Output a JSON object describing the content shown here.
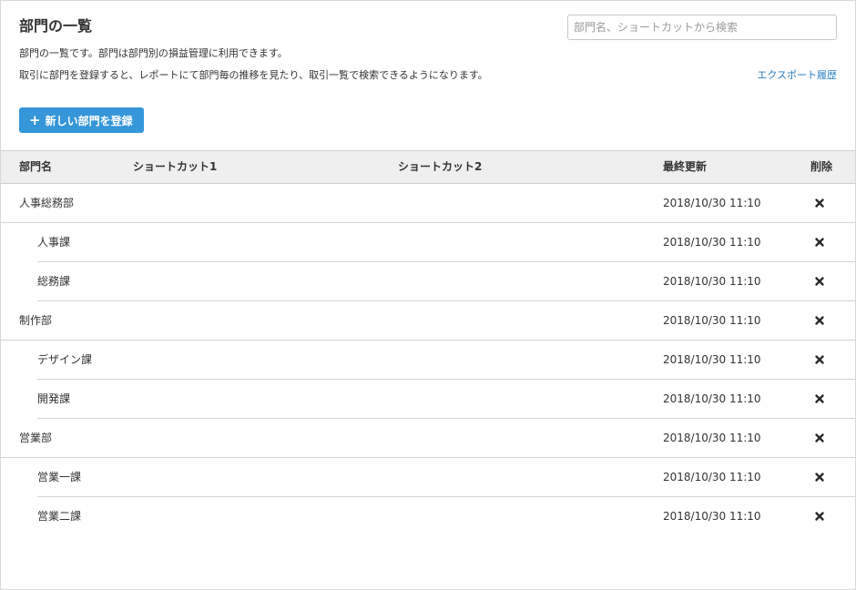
{
  "header": {
    "title": "部門の一覧",
    "search_placeholder": "部門名、ショートカットから検索",
    "search_value": "",
    "description_line1": "部門の一覧です。部門は部門別の損益管理に利用できます。",
    "description_line2": "取引に部門を登録すると、レポートにて部門毎の推移を見たり、取引一覧で検索できるようになります。",
    "export_link": "エクスポート履歴"
  },
  "actions": {
    "add_button_icon": "plus-icon",
    "add_button_label": "新しい部門を登録",
    "accent_color": "#3596d9"
  },
  "table": {
    "columns": {
      "name": "部門名",
      "shortcut1": "ショートカット1",
      "shortcut2": "ショートカット2",
      "updated": "最終更新",
      "delete": "削除"
    },
    "delete_icon": "close-icon",
    "rows": [
      {
        "name": "人事総務部",
        "level": 0,
        "shortcut1": "",
        "shortcut2": "",
        "updated": "2018/10/30 11:10"
      },
      {
        "name": "人事課",
        "level": 1,
        "shortcut1": "",
        "shortcut2": "",
        "updated": "2018/10/30 11:10"
      },
      {
        "name": "総務課",
        "level": 1,
        "shortcut1": "",
        "shortcut2": "",
        "updated": "2018/10/30 11:10"
      },
      {
        "name": "制作部",
        "level": 0,
        "shortcut1": "",
        "shortcut2": "",
        "updated": "2018/10/30 11:10"
      },
      {
        "name": "デザイン課",
        "level": 1,
        "shortcut1": "",
        "shortcut2": "",
        "updated": "2018/10/30 11:10"
      },
      {
        "name": "開発課",
        "level": 1,
        "shortcut1": "",
        "shortcut2": "",
        "updated": "2018/10/30 11:10"
      },
      {
        "name": "営業部",
        "level": 0,
        "shortcut1": "",
        "shortcut2": "",
        "updated": "2018/10/30 11:10"
      },
      {
        "name": "営業一課",
        "level": 1,
        "shortcut1": "",
        "shortcut2": "",
        "updated": "2018/10/30 11:10"
      },
      {
        "name": "営業二課",
        "level": 1,
        "shortcut1": "",
        "shortcut2": "",
        "updated": "2018/10/30 11:10"
      }
    ]
  }
}
